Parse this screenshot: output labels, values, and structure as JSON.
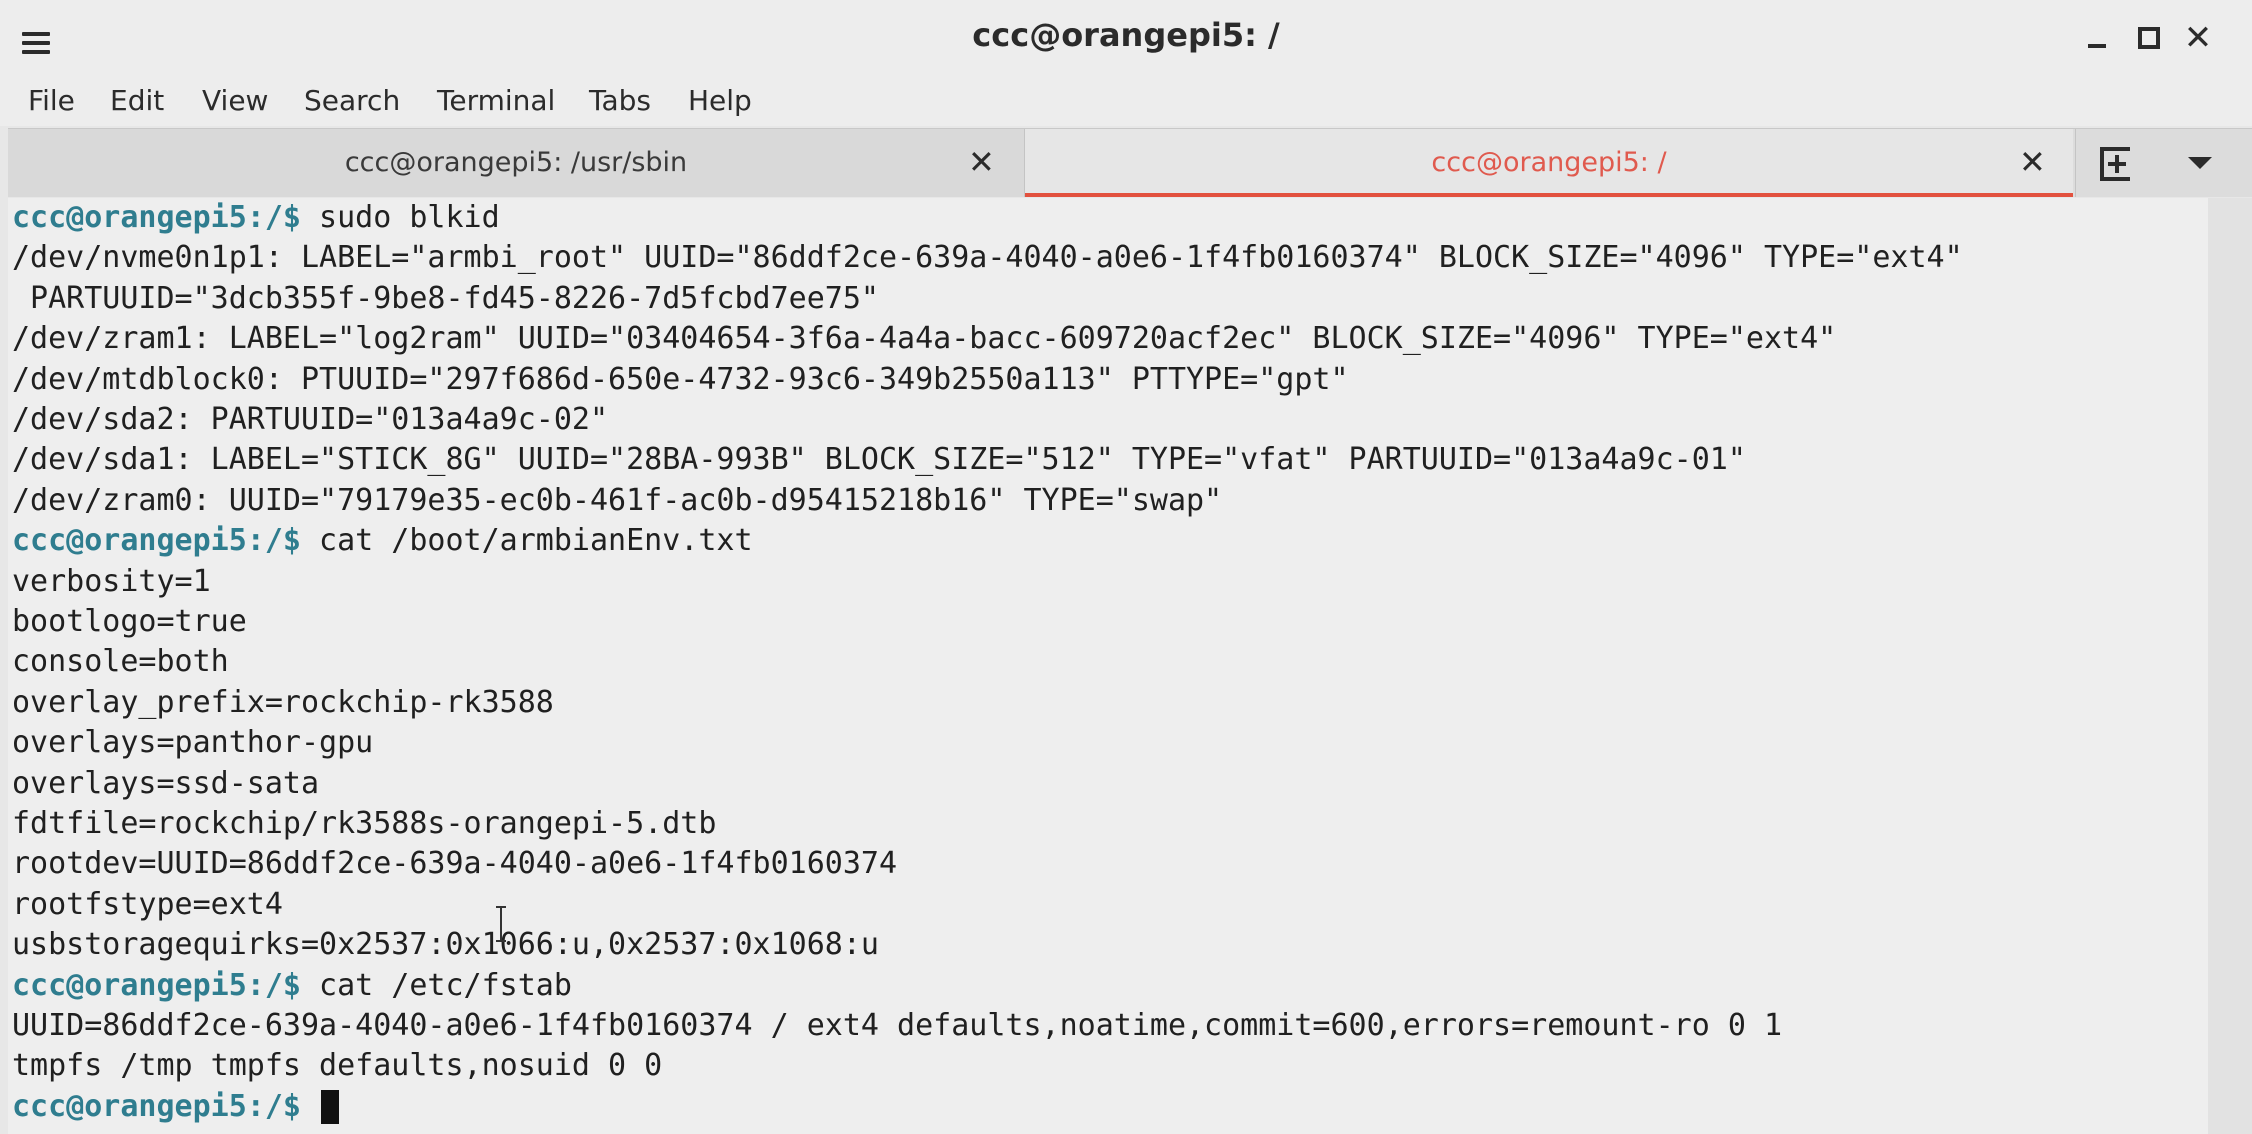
{
  "window": {
    "title": "ccc@orangepi5: /",
    "menu_icon": "hamburger-menu-icon",
    "close_glyph": "✕"
  },
  "menubar": {
    "items": [
      "File",
      "Edit",
      "View",
      "Search",
      "Terminal",
      "Tabs",
      "Help"
    ]
  },
  "tabs": [
    {
      "label": "ccc@orangepi5: /usr/sbin",
      "active": false,
      "close": "✕"
    },
    {
      "label": "ccc@orangepi5: /",
      "active": true,
      "close": "✕"
    }
  ],
  "colors": {
    "prompt": "#2f7d8f",
    "active_tab_accent": "#e2513e",
    "terminal_bg": "#eeeeee"
  },
  "terminal": {
    "prompt": "ccc@orangepi5:/$",
    "lines": [
      {
        "prompt": "ccc@orangepi5:/$",
        "text": " sudo blkid"
      },
      {
        "prompt": "",
        "text": "/dev/nvme0n1p1: LABEL=\"armbi_root\" UUID=\"86ddf2ce-639a-4040-a0e6-1f4fb0160374\" BLOCK_SIZE=\"4096\" TYPE=\"ext4\""
      },
      {
        "prompt": "",
        "text": " PARTUUID=\"3dcb355f-9be8-fd45-8226-7d5fcbd7ee75\""
      },
      {
        "prompt": "",
        "text": "/dev/zram1: LABEL=\"log2ram\" UUID=\"03404654-3f6a-4a4a-bacc-609720acf2ec\" BLOCK_SIZE=\"4096\" TYPE=\"ext4\""
      },
      {
        "prompt": "",
        "text": "/dev/mtdblock0: PTUUID=\"297f686d-650e-4732-93c6-349b2550a113\" PTTYPE=\"gpt\""
      },
      {
        "prompt": "",
        "text": "/dev/sda2: PARTUUID=\"013a4a9c-02\""
      },
      {
        "prompt": "",
        "text": "/dev/sda1: LABEL=\"STICK_8G\" UUID=\"28BA-993B\" BLOCK_SIZE=\"512\" TYPE=\"vfat\" PARTUUID=\"013a4a9c-01\""
      },
      {
        "prompt": "",
        "text": "/dev/zram0: UUID=\"79179e35-ec0b-461f-ac0b-d95415218b16\" TYPE=\"swap\""
      },
      {
        "prompt": "ccc@orangepi5:/$",
        "text": " cat /boot/armbianEnv.txt"
      },
      {
        "prompt": "",
        "text": "verbosity=1"
      },
      {
        "prompt": "",
        "text": "bootlogo=true"
      },
      {
        "prompt": "",
        "text": "console=both"
      },
      {
        "prompt": "",
        "text": "overlay_prefix=rockchip-rk3588"
      },
      {
        "prompt": "",
        "text": "overlays=panthor-gpu"
      },
      {
        "prompt": "",
        "text": "overlays=ssd-sata"
      },
      {
        "prompt": "",
        "text": "fdtfile=rockchip/rk3588s-orangepi-5.dtb"
      },
      {
        "prompt": "",
        "text": "rootdev=UUID=86ddf2ce-639a-4040-a0e6-1f4fb0160374"
      },
      {
        "prompt": "",
        "text": "rootfstype=ext4"
      },
      {
        "prompt": "",
        "text": "usbstoragequirks=0x2537:0x1066:u,0x2537:0x1068:u"
      },
      {
        "prompt": "ccc@orangepi5:/$",
        "text": " cat /etc/fstab"
      },
      {
        "prompt": "",
        "text": "UUID=86ddf2ce-639a-4040-a0e6-1f4fb0160374 / ext4 defaults,noatime,commit=600,errors=remount-ro 0 1"
      },
      {
        "prompt": "",
        "text": "tmpfs /tmp tmpfs defaults,nosuid 0 0"
      },
      {
        "prompt": "ccc@orangepi5:/$",
        "text": " ",
        "cursor": true
      }
    ]
  }
}
